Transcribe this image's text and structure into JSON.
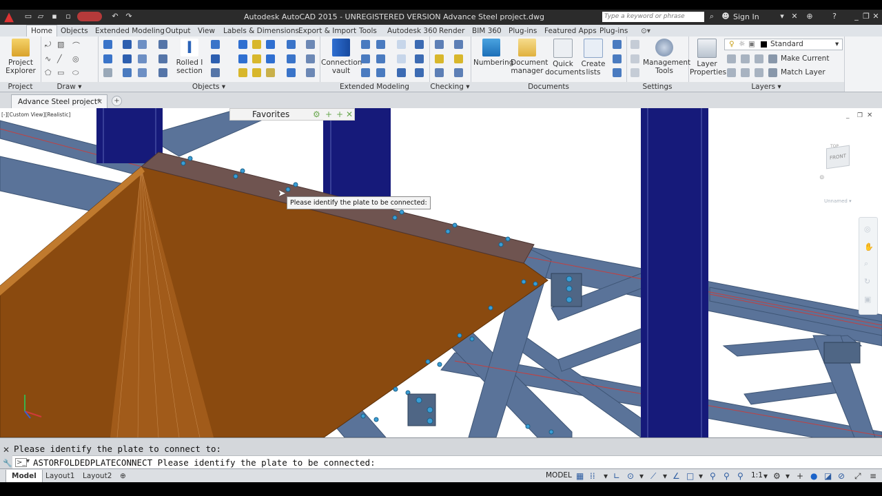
{
  "app": {
    "title": "Autodesk AutoCAD 2015 - UNREGISTERED VERSION    Advance Steel project.dwg",
    "search_placeholder": "Type a keyword or phrase",
    "sign_in": "Sign In"
  },
  "ribbon_tabs": [
    "Home",
    "Objects",
    "Extended Modeling",
    "Output",
    "View",
    "Labels & Dimensions",
    "Export & Import",
    "Tools",
    "Autodesk 360",
    "Render",
    "BIM 360",
    "Plug-ins",
    "Featured Apps",
    "Plug-ins"
  ],
  "panels": {
    "project": {
      "title": "Project",
      "explorer": "Project Explorer"
    },
    "draw": {
      "title": "Draw"
    },
    "objects": {
      "title": "Objects",
      "rolled": "Rolled I section"
    },
    "extended": {
      "title": "Extended Modeling",
      "vault": "Connection vault"
    },
    "checking": {
      "title": "Checking"
    },
    "documents": {
      "title": "Documents",
      "numbering": "Numbering",
      "doc_manager": "Document manager",
      "quick_docs": "Quick documents",
      "create_lists": "Create lists"
    },
    "settings": {
      "title": "Settings",
      "mgmt_tools": "Management Tools"
    },
    "layers": {
      "title": "Layers",
      "layer_props": "Layer Properties",
      "layer_name": "Standard",
      "make_current": "Make Current",
      "match_layer": "Match Layer"
    }
  },
  "document_tab": "Advance Steel project*",
  "viewport": {
    "view_label": "[-][Custom View][Realistic]",
    "favorites": "Favorites",
    "tooltip": "Please identify the plate to be connected:",
    "viewcube_face": "FRONT",
    "viewcube_top": "TOP",
    "unnamed": "Unnamed"
  },
  "command": {
    "history": "Please identify the plate to connect to:",
    "current": "ASTORFOLDEDPLATECONNECT Please identify the plate to be connected:"
  },
  "status": {
    "layouts": [
      "Model",
      "Layout1",
      "Layout2"
    ],
    "model": "MODEL",
    "scale": "1:1"
  },
  "colors": {
    "steel": "#5a7399",
    "column": "#161a7a",
    "plate": "#8a4a0f",
    "plate_dark": "#6a3608"
  }
}
